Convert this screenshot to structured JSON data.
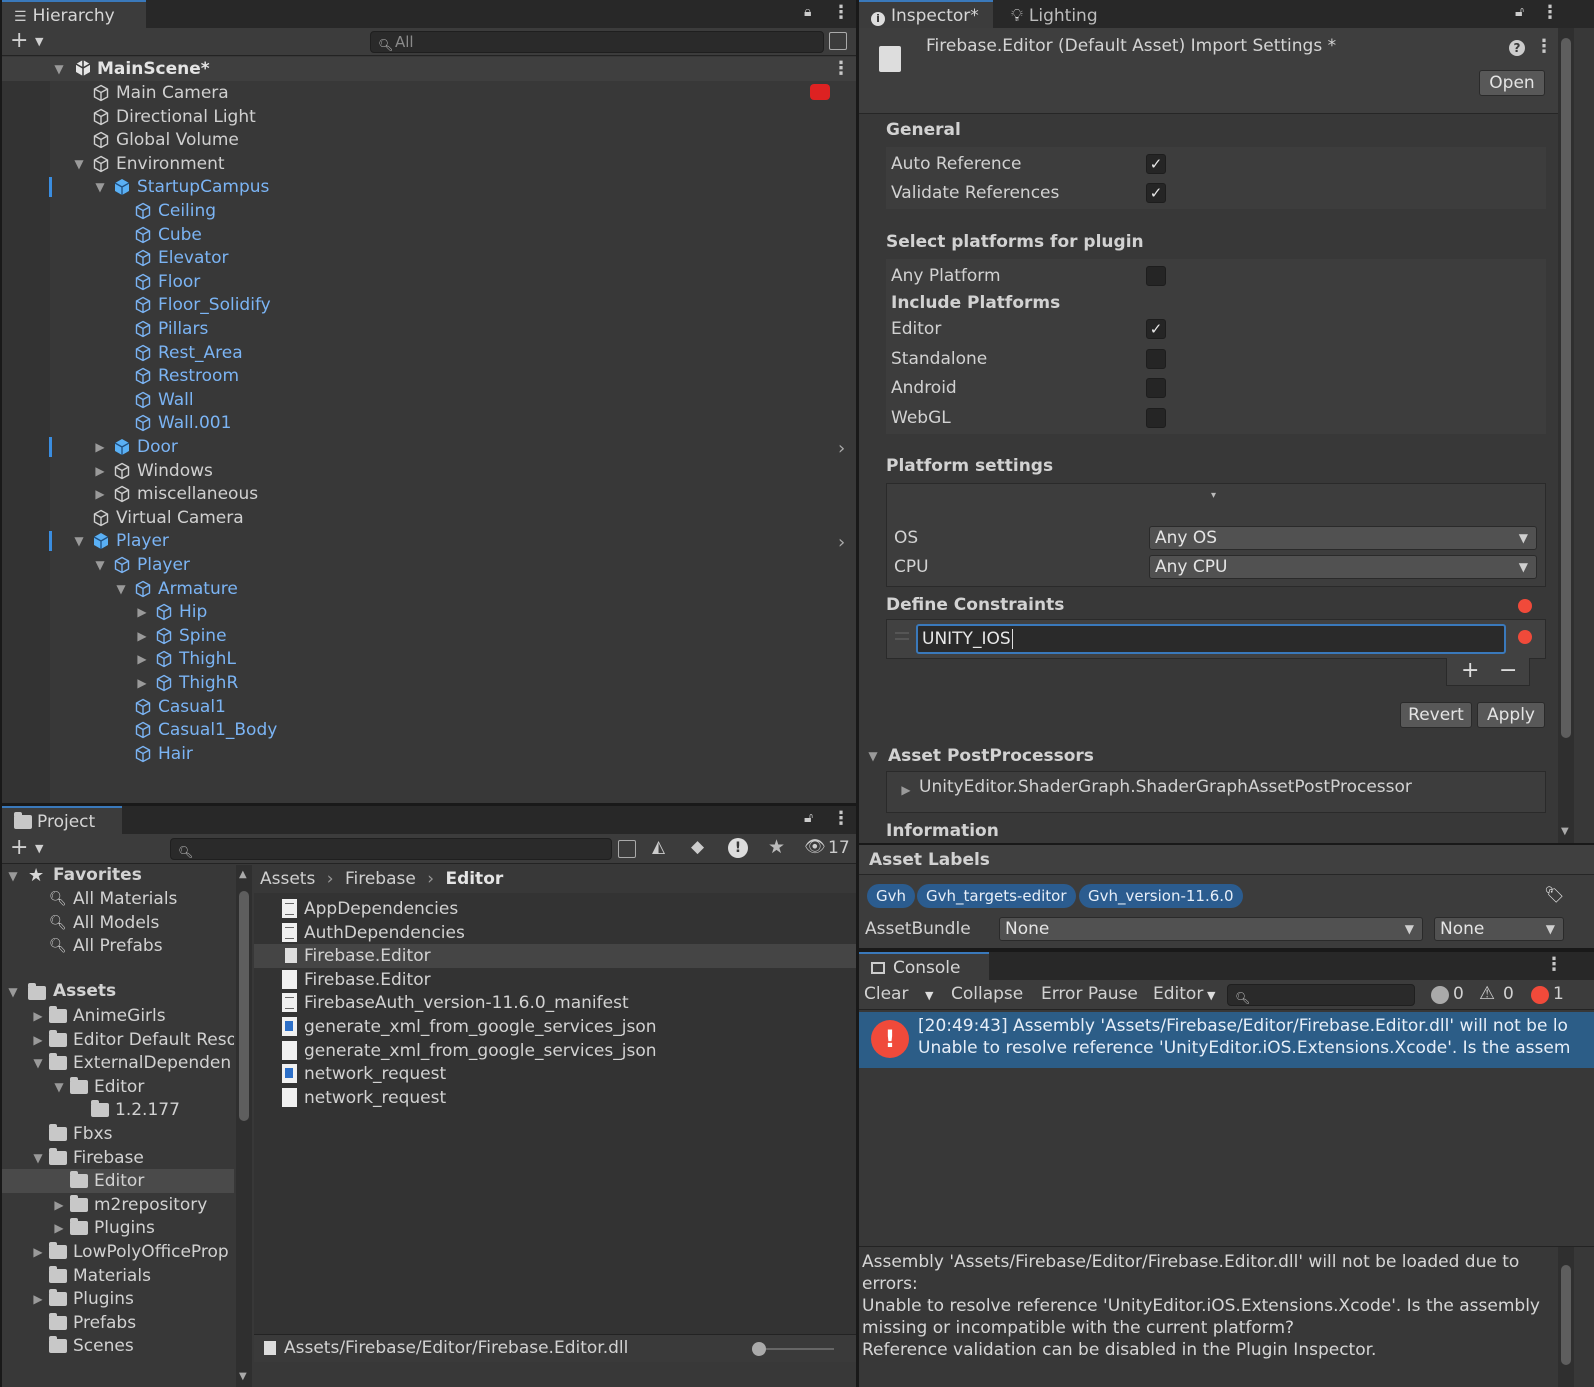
{
  "hierarchy": {
    "tab_label": "Hierarchy",
    "search_placeholder": "All",
    "scene": "MainScene*",
    "items": [
      {
        "label": "Main Camera",
        "depth": 0,
        "blue": false
      },
      {
        "label": "Directional Light",
        "depth": 0,
        "blue": false
      },
      {
        "label": "Global Volume",
        "depth": 0,
        "blue": false
      },
      {
        "label": "Environment",
        "depth": 0,
        "blue": false
      },
      {
        "label": "StartupCampus",
        "depth": 1,
        "blue": true
      },
      {
        "label": "Ceiling",
        "depth": 2,
        "blue": true
      },
      {
        "label": "Cube",
        "depth": 2,
        "blue": true
      },
      {
        "label": "Elevator",
        "depth": 2,
        "blue": true
      },
      {
        "label": "Floor",
        "depth": 2,
        "blue": true
      },
      {
        "label": "Floor_Solidify",
        "depth": 2,
        "blue": true
      },
      {
        "label": "Pillars",
        "depth": 2,
        "blue": true
      },
      {
        "label": "Rest_Area",
        "depth": 2,
        "blue": true
      },
      {
        "label": "Restroom",
        "depth": 2,
        "blue": true
      },
      {
        "label": "Wall",
        "depth": 2,
        "blue": true
      },
      {
        "label": "Wall.001",
        "depth": 2,
        "blue": true
      },
      {
        "label": "Door",
        "depth": 1,
        "blue": true
      },
      {
        "label": "Windows",
        "depth": 1,
        "blue": false
      },
      {
        "label": "miscellaneous",
        "depth": 1,
        "blue": false
      },
      {
        "label": "Virtual Camera",
        "depth": 0,
        "blue": false
      },
      {
        "label": "Player",
        "depth": 0,
        "blue": true
      },
      {
        "label": "Player",
        "depth": 1,
        "blue": true
      },
      {
        "label": "Armature",
        "depth": 2,
        "blue": true
      },
      {
        "label": "Hip",
        "depth": 3,
        "blue": true
      },
      {
        "label": "Spine",
        "depth": 3,
        "blue": true
      },
      {
        "label": "ThighL",
        "depth": 3,
        "blue": true
      },
      {
        "label": "ThighR",
        "depth": 3,
        "blue": true
      },
      {
        "label": "Casual1",
        "depth": 2,
        "blue": true
      },
      {
        "label": "Casual1_Body",
        "depth": 2,
        "blue": true
      },
      {
        "label": "Hair",
        "depth": 2,
        "blue": true
      }
    ]
  },
  "project": {
    "tab_label": "Project",
    "hidden_count": "17",
    "favorites": {
      "label": "Favorites",
      "items": [
        "All Materials",
        "All Models",
        "All Prefabs"
      ]
    },
    "assets": {
      "label": "Assets",
      "items": [
        {
          "label": "AnimeGirls",
          "depth": 1
        },
        {
          "label": "Editor Default Reso",
          "depth": 1
        },
        {
          "label": "ExternalDependen",
          "depth": 1
        },
        {
          "label": "Editor",
          "depth": 2
        },
        {
          "label": "1.2.177",
          "depth": 3
        },
        {
          "label": "Fbxs",
          "depth": 1
        },
        {
          "label": "Firebase",
          "depth": 1
        },
        {
          "label": "Editor",
          "depth": 2
        },
        {
          "label": "m2repository",
          "depth": 2
        },
        {
          "label": "Plugins",
          "depth": 2
        },
        {
          "label": "LowPolyOfficeProp",
          "depth": 1
        },
        {
          "label": "Materials",
          "depth": 1
        },
        {
          "label": "Plugins",
          "depth": 1
        },
        {
          "label": "Prefabs",
          "depth": 1
        },
        {
          "label": "Scenes",
          "depth": 1
        }
      ]
    },
    "breadcrumb": [
      "Assets",
      "Firebase",
      "Editor"
    ],
    "files": [
      {
        "label": "AppDependencies",
        "icon": "text-doc-icon"
      },
      {
        "label": "AuthDependencies",
        "icon": "text-doc-icon"
      },
      {
        "label": "Firebase.Editor",
        "icon": "plugin-icon"
      },
      {
        "label": "Firebase.Editor",
        "icon": "blank-doc-icon"
      },
      {
        "label": "FirebaseAuth_version-11.6.0_manifest",
        "icon": "text-doc-icon"
      },
      {
        "label": "generate_xml_from_google_services_json",
        "icon": "exe-icon"
      },
      {
        "label": "generate_xml_from_google_services_json",
        "icon": "blank-doc-icon"
      },
      {
        "label": "network_request",
        "icon": "exe-icon"
      },
      {
        "label": "network_request",
        "icon": "blank-doc-icon"
      }
    ],
    "status_path": "Assets/Firebase/Editor/Firebase.Editor.dll"
  },
  "inspector": {
    "tab_label": "Inspector*",
    "lighting_tab": "Lighting",
    "title": "Firebase.Editor (Default Asset) Import Settings *",
    "open_button": "Open",
    "general": {
      "title": "General",
      "auto_reference": "Auto Reference",
      "validate_references": "Validate References"
    },
    "platforms": {
      "title": "Select platforms for plugin",
      "any_platform": "Any Platform",
      "include_platforms": "Include Platforms",
      "editor": "Editor",
      "standalone": "Standalone",
      "android": "Android",
      "webgl": "WebGL"
    },
    "platform_settings": {
      "title": "Platform settings",
      "os_label": "OS",
      "os_value": "Any OS",
      "cpu_label": "CPU",
      "cpu_value": "Any CPU"
    },
    "define_constraints": {
      "title": "Define Constraints",
      "value": "UNITY_IOS"
    },
    "revert": "Revert",
    "apply": "Apply",
    "postprocessors": {
      "title": "Asset PostProcessors",
      "item": "UnityEditor.ShaderGraph.ShaderGraphAssetPostProcessor"
    },
    "information": "Information"
  },
  "asset_labels": {
    "title": "Asset Labels",
    "labels": [
      "Gvh",
      "Gvh_targets-editor",
      "Gvh_version-11.6.0"
    ],
    "assetbundle_label": "AssetBundle",
    "assetbundle_value": "None",
    "variant_value": "None"
  },
  "console": {
    "tab_label": "Console",
    "clear": "Clear",
    "collapse": "Collapse",
    "error_pause": "Error Pause",
    "editor": "Editor",
    "log_count": "0",
    "warn_count": "0",
    "error_count": "1",
    "message_line1": "[20:49:43] Assembly 'Assets/Firebase/Editor/Firebase.Editor.dll' will not be lo",
    "message_line2": "Unable to resolve reference 'UnityEditor.iOS.Extensions.Xcode'. Is the assem",
    "detail": [
      "Assembly 'Assets/Firebase/Editor/Firebase.Editor.dll' will not be loaded due to",
      "errors:",
      "Unable to resolve reference 'UnityEditor.iOS.Extensions.Xcode'. Is the assembly",
      "missing or incompatible with the current platform?",
      "Reference validation can be disabled in the Plugin Inspector."
    ]
  },
  "colors": {
    "accent": "#3a79bb",
    "selected_row": "#2c5d87",
    "error": "#f04a3a",
    "blue_text": "#7bb4f4"
  }
}
